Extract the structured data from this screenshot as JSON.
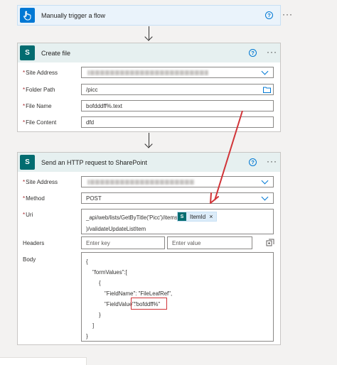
{
  "trigger": {
    "title": "Manually trigger a flow",
    "help_glyph": "?",
    "more_glyph": "···",
    "icon": "hand-tap-icon",
    "color": "#0078d4"
  },
  "create_file": {
    "title": "Create file",
    "help_glyph": "?",
    "more_glyph": "···",
    "icon": "sharepoint-icon",
    "icon_letter": "S",
    "fields": {
      "site_address": {
        "label": "Site Address",
        "required": "*"
      },
      "folder_path": {
        "label": "Folder Path",
        "required": "*",
        "value": "/picc"
      },
      "file_name": {
        "label": "File Name",
        "required": "*",
        "value": "bofdddff%.text"
      },
      "file_content": {
        "label": "File Content",
        "required": "*",
        "value": "dfd"
      }
    }
  },
  "http_request": {
    "title": "Send an HTTP request to SharePoint",
    "help_glyph": "?",
    "more_glyph": "···",
    "icon": "sharepoint-icon",
    "icon_letter": "S",
    "fields": {
      "site_address": {
        "label": "Site Address",
        "required": "*"
      },
      "method": {
        "label": "Method",
        "required": "*",
        "value": "POST"
      },
      "uri": {
        "label": "Uri",
        "required": "*",
        "line1": "_api/web/lists/GetByTitle('Picc')/items(",
        "token": "ItemId",
        "token_close": "×",
        "line2": ")/validateUpdateListItem"
      },
      "headers": {
        "label": "Headers",
        "key_placeholder": "Enter key",
        "value_placeholder": "Enter value"
      },
      "body": {
        "label": "Body",
        "lines": [
          "{",
          "\"formValues\":[",
          "{",
          "\"FieldName\": \"FileLeafRef\",",
          "\"FieldValue\":",
          "\"bofddff%\"",
          "}",
          "]",
          "}"
        ]
      }
    }
  },
  "colors": {
    "accent": "#0078d4",
    "sharepoint": "#036c70",
    "header_bg": "#e6f0f0",
    "annotation": "#d13438"
  }
}
